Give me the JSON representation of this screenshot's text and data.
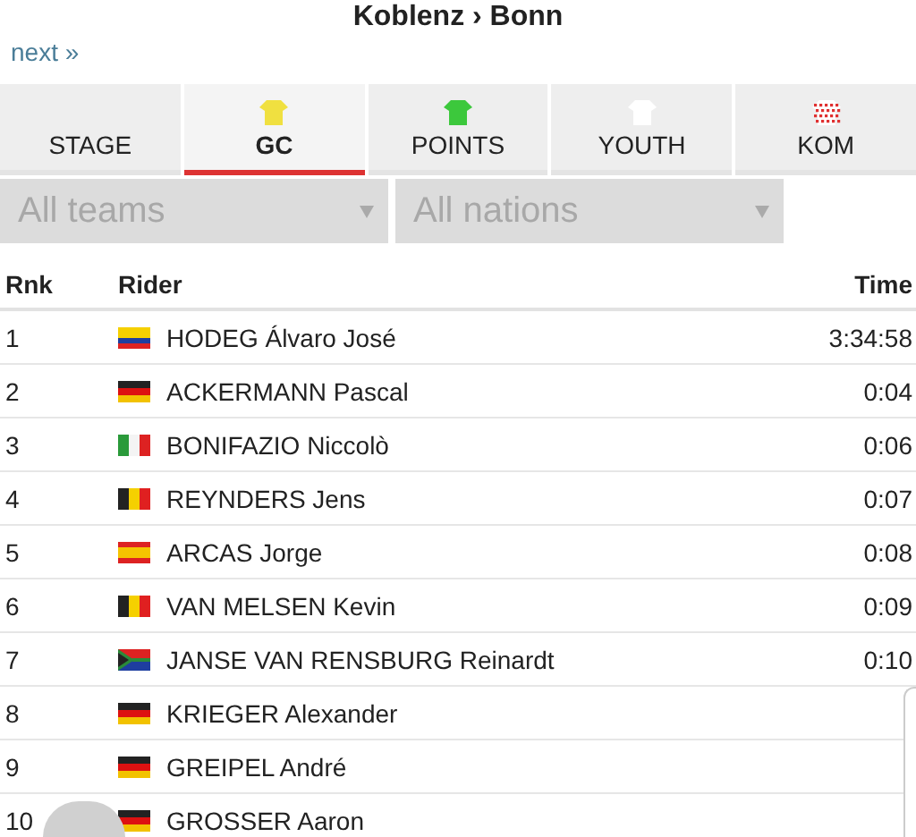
{
  "title": "Koblenz › Bonn",
  "next_link": "next »",
  "tabs": [
    {
      "label": "STAGE",
      "selected": false,
      "kind": "none"
    },
    {
      "label": "GC",
      "selected": true,
      "kind": "solid",
      "color": "#f0e040"
    },
    {
      "label": "POINTS",
      "selected": false,
      "kind": "solid",
      "color": "#3cc83c"
    },
    {
      "label": "YOUTH",
      "selected": false,
      "kind": "solid",
      "color": "#ffffff"
    },
    {
      "label": "KOM",
      "selected": false,
      "kind": "polka",
      "color": "#e03030"
    }
  ],
  "filters": [
    {
      "placeholder": "All teams"
    },
    {
      "placeholder": "All nations"
    }
  ],
  "table": {
    "columns": [
      "Rnk",
      "Rider",
      "Time"
    ],
    "rows": [
      {
        "rank": "1",
        "kind": "co",
        "rider": "HODEG Álvaro José",
        "time": "3:34:58"
      },
      {
        "rank": "2",
        "kind": "de",
        "rider": "ACKERMANN Pascal",
        "time": "0:04"
      },
      {
        "rank": "3",
        "kind": "it",
        "rider": "BONIFAZIO Niccolò",
        "time": "0:06"
      },
      {
        "rank": "4",
        "kind": "be",
        "rider": "REYNDERS Jens",
        "time": "0:07"
      },
      {
        "rank": "5",
        "kind": "es",
        "rider": "ARCAS Jorge",
        "time": "0:08"
      },
      {
        "rank": "6",
        "kind": "be",
        "rider": "VAN MELSEN Kevin",
        "time": "0:09"
      },
      {
        "rank": "7",
        "kind": "za",
        "rider": "JANSE VAN RENSBURG Reinardt",
        "time": "0:10"
      },
      {
        "rank": "8",
        "kind": "de",
        "rider": "KRIEGER Alexander"
      },
      {
        "rank": "9",
        "kind": "de",
        "rider": "GREIPEL André"
      },
      {
        "rank": "10",
        "kind": "de",
        "rider": "GROSSER Aaron"
      }
    ]
  }
}
